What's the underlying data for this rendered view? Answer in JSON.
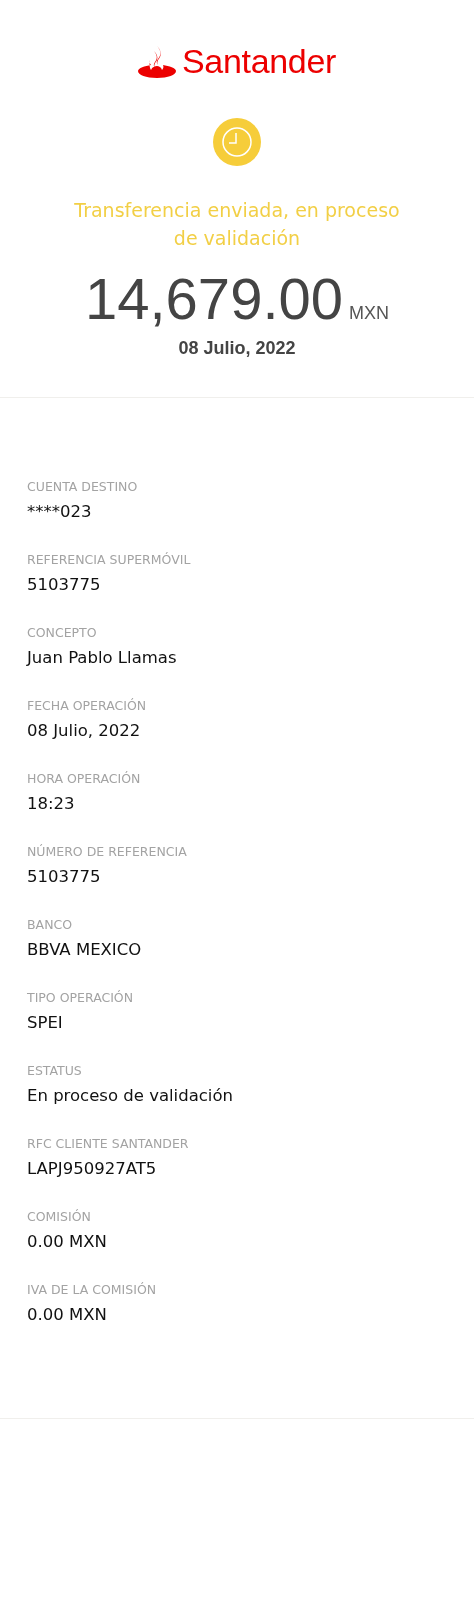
{
  "brand": "Santander",
  "status": {
    "message": "Transferencia enviada, en proceso de validación"
  },
  "amount": {
    "value": "14,679.00",
    "currency": "MXN"
  },
  "date": "08 Julio, 2022",
  "details": [
    {
      "label": "CUENTA DESTINO",
      "value": "****023"
    },
    {
      "label": "REFERENCIA SUPERMÓVIL",
      "value": "5103775"
    },
    {
      "label": "CONCEPTO",
      "value": "Juan Pablo Llamas"
    },
    {
      "label": "FECHA OPERACIÓN",
      "value": "08 Julio, 2022"
    },
    {
      "label": "HORA OPERACIÓN",
      "value": "18:23"
    },
    {
      "label": "NÚMERO DE REFERENCIA",
      "value": "5103775"
    },
    {
      "label": "BANCO",
      "value": "BBVA MEXICO"
    },
    {
      "label": "TIPO OPERACIÓN",
      "value": "SPEI"
    },
    {
      "label": "ESTATUS",
      "value": "En proceso de validación"
    },
    {
      "label": "RFC CLIENTE SANTANDER",
      "value": "LAPJ950927AT5"
    },
    {
      "label": "COMISIÓN",
      "value": "0.00 MXN"
    },
    {
      "label": "IVA DE LA COMISIÓN",
      "value": "0.00 MXN"
    }
  ]
}
